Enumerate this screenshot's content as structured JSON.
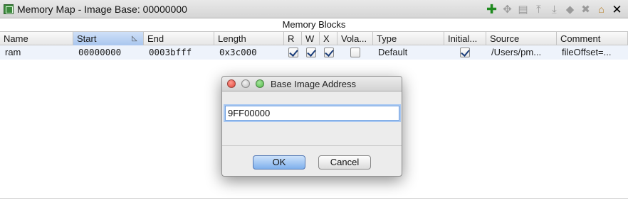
{
  "window": {
    "title": "Memory Map - Image Base: 00000000",
    "toolbar_icons": [
      "add-icon",
      "move-icon",
      "split-icon",
      "expand-up-icon",
      "expand-down-icon",
      "merge-icon",
      "delete-icon",
      "home-icon",
      "close-icon"
    ]
  },
  "section": {
    "title": "Memory Blocks"
  },
  "table": {
    "columns": [
      "Name",
      "Start",
      "End",
      "Length",
      "R",
      "W",
      "X",
      "Vola...",
      "Type",
      "Initial...",
      "Source",
      "Comment"
    ],
    "rows": [
      {
        "name": "ram",
        "start": "00000000",
        "end": "0003bfff",
        "length": "0x3c000",
        "r": true,
        "w": true,
        "x": true,
        "volatile": false,
        "type": "Default",
        "initialized": true,
        "source": "/Users/pm...",
        "comment": "fileOffset=..."
      }
    ]
  },
  "dialog": {
    "title": "Base Image Address",
    "input_value": "9FF00000",
    "ok_label": "OK",
    "cancel_label": "Cancel"
  }
}
